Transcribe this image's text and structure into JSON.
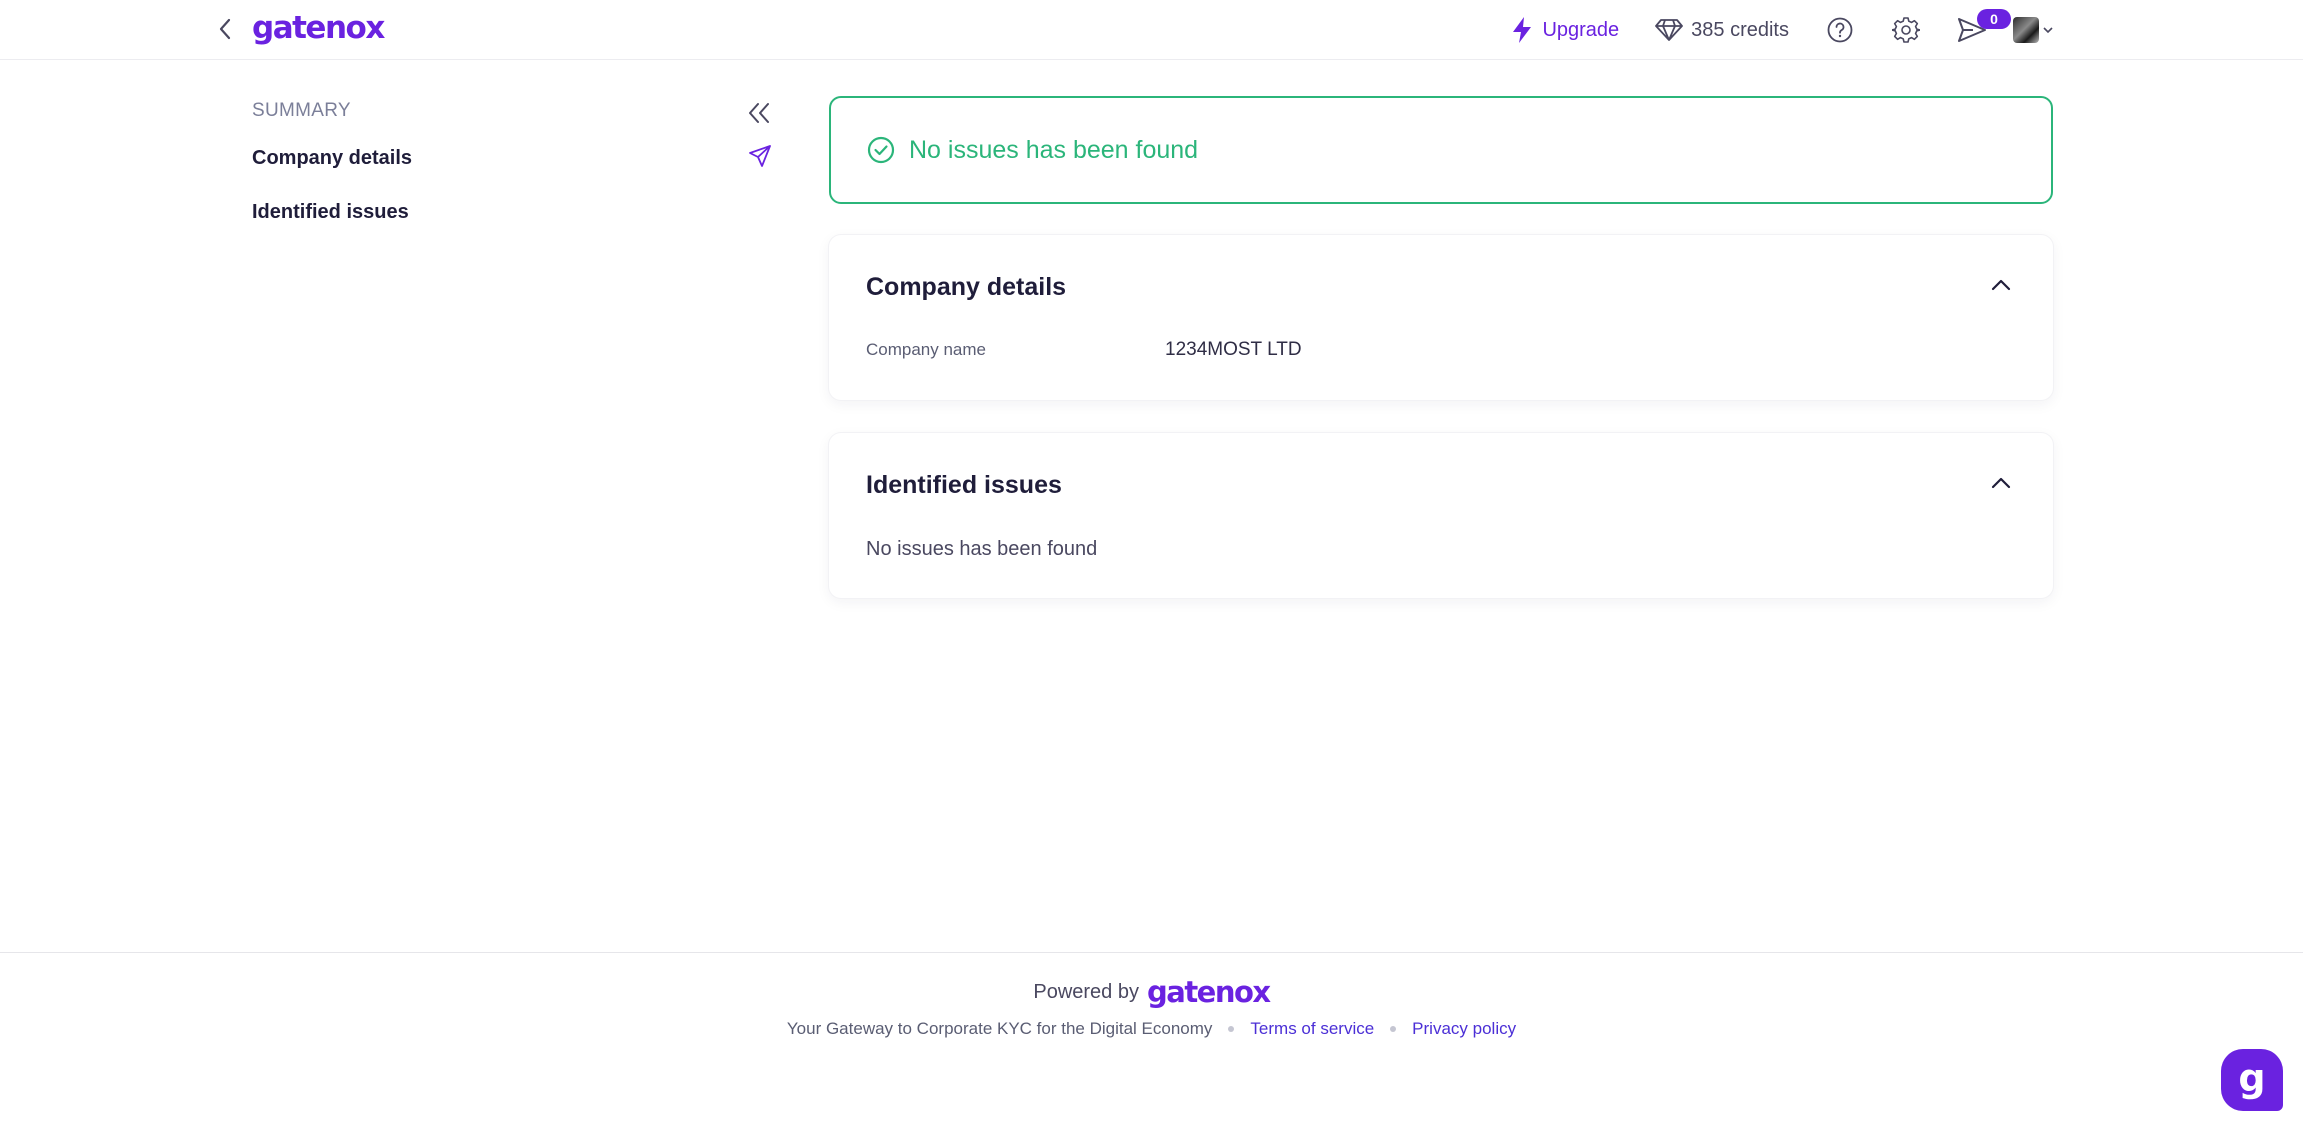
{
  "header": {
    "logo": "gatenox",
    "upgrade_label": "Upgrade",
    "credits_label": "385 credits",
    "notification_count": "0"
  },
  "sidebar": {
    "section_label": "SUMMARY",
    "items": [
      {
        "label": "Company details"
      },
      {
        "label": "Identified issues"
      }
    ]
  },
  "main": {
    "status_alert": "No issues has been found",
    "company_card": {
      "title": "Company details",
      "field_label": "Company name",
      "field_value": "1234MOST LTD"
    },
    "issues_card": {
      "title": "Identified issues",
      "message": "No issues has been found"
    }
  },
  "footer": {
    "powered_by": "Powered by",
    "logo": "gatenox",
    "tagline": "Your Gateway to Corporate KYC for the Digital Economy",
    "terms": "Terms of service",
    "privacy": "Privacy policy"
  },
  "chat": {
    "letter": "g"
  },
  "colors": {
    "brand": "#6a22e0",
    "success": "#2bb57a",
    "text": "#1f1d3a",
    "link": "#4b2fd6"
  },
  "icons": [
    "chevron-left-icon",
    "bolt-icon",
    "diamond-icon",
    "help-icon",
    "gear-icon",
    "send-icon",
    "chevron-double-left-icon",
    "check-circle-icon",
    "chevron-up-icon"
  ]
}
